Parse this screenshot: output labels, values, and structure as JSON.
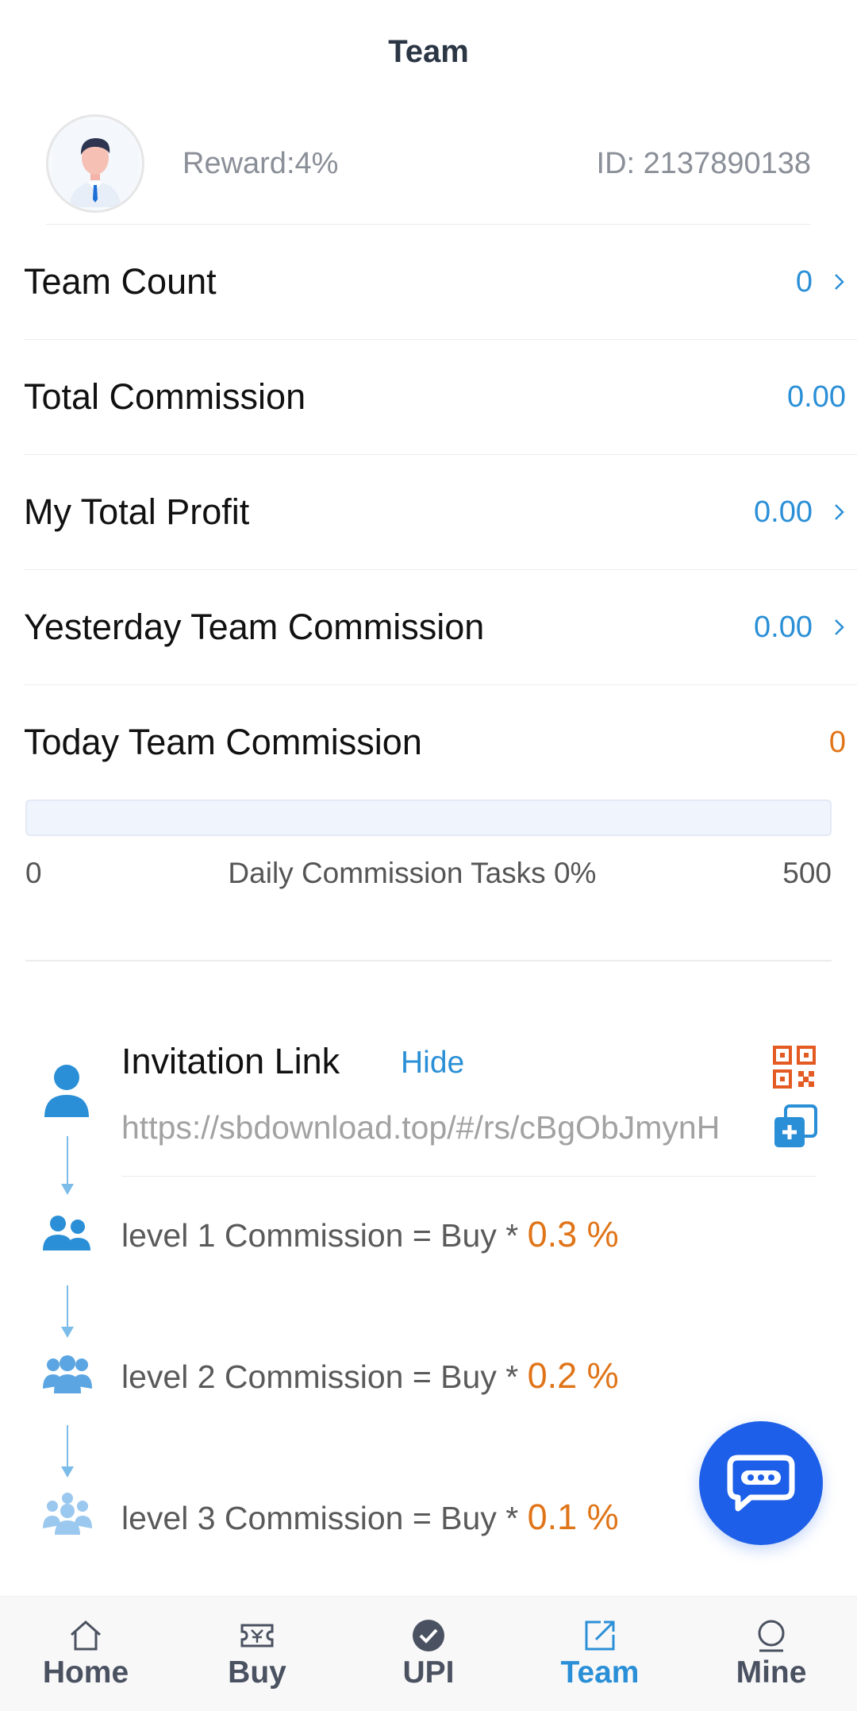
{
  "header": {
    "title": "Team"
  },
  "profile": {
    "reward": "Reward:4%",
    "id": "ID: 2137890138"
  },
  "stats": [
    {
      "label": "Team Count",
      "value": "0",
      "chevron": true
    },
    {
      "label": "Total Commission",
      "value": "0.00",
      "chevron": false
    },
    {
      "label": "My Total Profit",
      "value": "0.00",
      "chevron": true
    },
    {
      "label": "Yesterday Team Commission",
      "value": "0.00",
      "chevron": true
    }
  ],
  "today": {
    "label": "Today Team Commission",
    "value": "0"
  },
  "progress": {
    "min": "0",
    "max": "500",
    "label": "Daily Commission Tasks 0%",
    "fraction": 0
  },
  "invitation": {
    "title": "Invitation Link",
    "hide_label": "Hide",
    "link": "https://sbdownload.top/#/rs/cBgObJmynH",
    "levels": [
      {
        "text": "level 1 Commission = Buy * ",
        "pct": "0.3 %"
      },
      {
        "text": "level 2 Commission = Buy * ",
        "pct": "0.2 %"
      },
      {
        "text": "level 3 Commission = Buy * ",
        "pct": "0.1 %"
      }
    ]
  },
  "tabbar": {
    "items": [
      {
        "label": "Home",
        "icon": "home-icon"
      },
      {
        "label": "Buy",
        "icon": "ticket-icon"
      },
      {
        "label": "UPI",
        "icon": "check-circle-icon"
      },
      {
        "label": "Team",
        "icon": "share-icon",
        "active": true
      },
      {
        "label": "Mine",
        "icon": "person-icon"
      }
    ]
  },
  "colors": {
    "accent": "#2a8fd6",
    "orange": "#e07418",
    "fab": "#1d5fe8"
  }
}
